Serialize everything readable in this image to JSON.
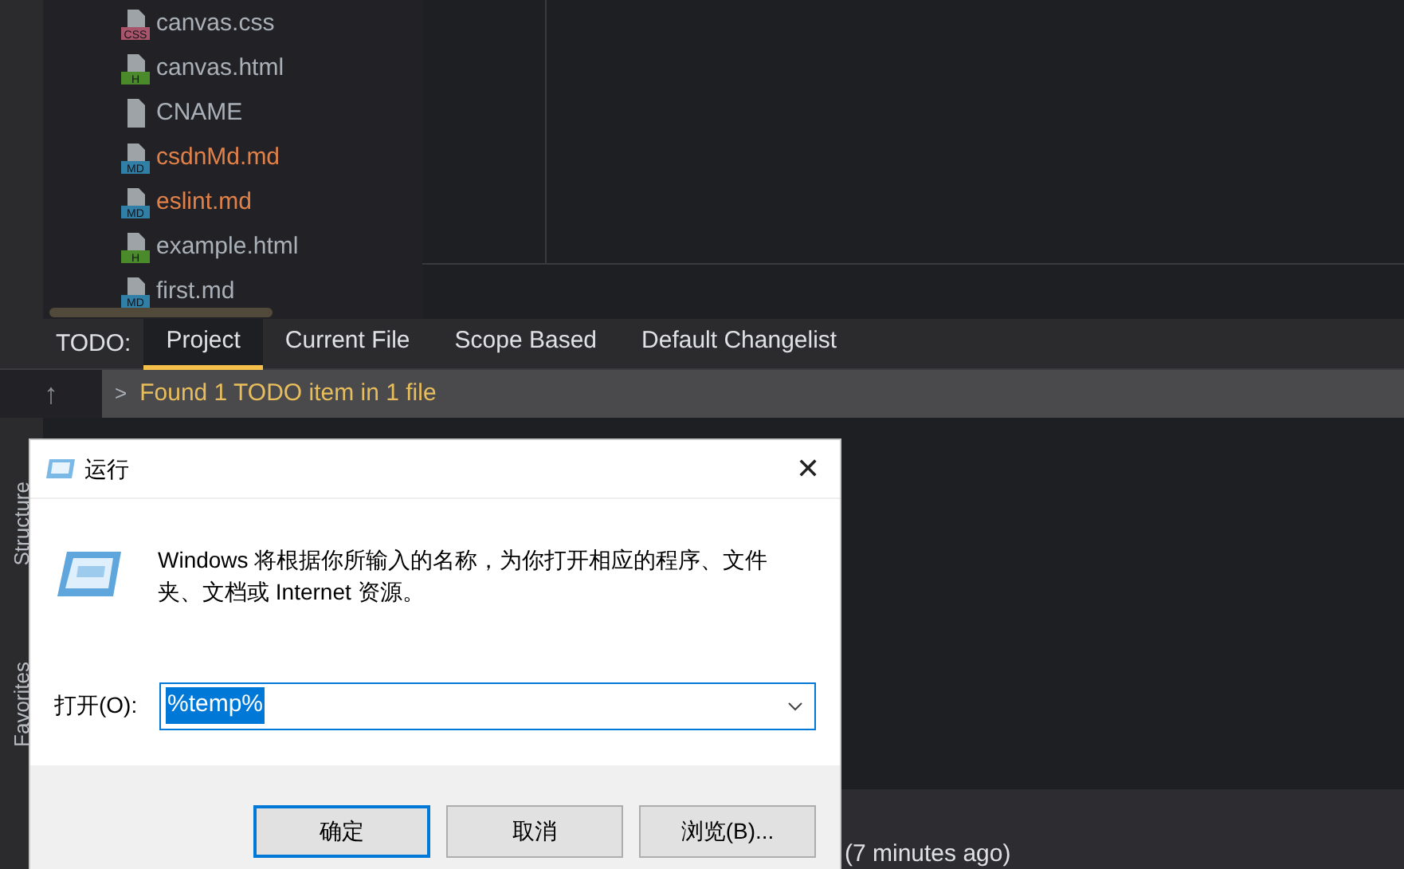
{
  "files": [
    {
      "name": "canvas.css",
      "kind": "css",
      "badge": "CSS",
      "modified": false
    },
    {
      "name": "canvas.html",
      "kind": "html",
      "badge": "H",
      "modified": false
    },
    {
      "name": "CNAME",
      "kind": "text",
      "modified": false
    },
    {
      "name": "csdnMd.md",
      "kind": "md",
      "badge": "MD",
      "modified": true
    },
    {
      "name": "eslint.md",
      "kind": "md",
      "badge": "MD",
      "modified": true
    },
    {
      "name": "example.html",
      "kind": "html",
      "badge": "H",
      "modified": false
    },
    {
      "name": "first.md",
      "kind": "md",
      "badge": "MD",
      "modified": false
    }
  ],
  "todo": {
    "label": "TODO:",
    "tabs": [
      {
        "label": "Project",
        "selected": true
      },
      {
        "label": "Current File",
        "selected": false
      },
      {
        "label": "Scope Based",
        "selected": false
      },
      {
        "label": "Default Changelist",
        "selected": false
      }
    ],
    "result": "Found 1 TODO item in 1 file",
    "expand_glyph": ">",
    "up_glyph": "↑"
  },
  "side_tabs": [
    "Structure",
    "Favorites"
  ],
  "status_text": "(7 minutes ago)",
  "dialog": {
    "title": "运行",
    "close": "✕",
    "message": "Windows 将根据你所输入的名称，为你打开相应的程序、文件夹、文档或 Internet 资源。",
    "open_label": "打开(O):",
    "open_value": "%temp%",
    "buttons": [
      {
        "label": "确定",
        "selected": true
      },
      {
        "label": "取消",
        "selected": false
      },
      {
        "label": "浏览(B)...",
        "selected": false
      }
    ]
  }
}
